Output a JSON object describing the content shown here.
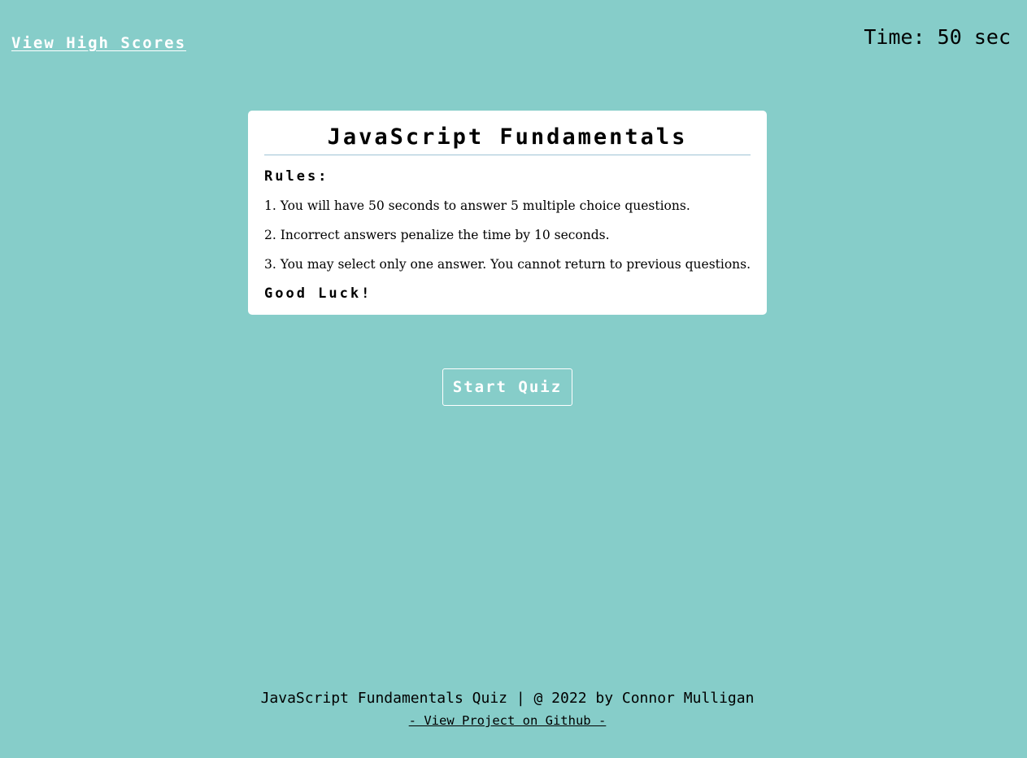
{
  "header": {
    "high_scores_label": "View High Scores",
    "timer_text": "Time: 50 sec"
  },
  "card": {
    "title": "JavaScript Fundamentals",
    "rules_heading": "Rules:",
    "rules": [
      "1. You will have 50 seconds to answer 5 multiple choice questions.",
      "2. Incorrect answers penalize the time by 10 seconds.",
      "3. You may select only one answer. You cannot return to previous questions."
    ],
    "closing": "Good Luck!"
  },
  "start_button_label": "Start Quiz",
  "footer": {
    "credit": "JavaScript Fundamentals Quiz | @ 2022 by Connor Mulligan",
    "github_link": "- View Project on Github -"
  },
  "colors": {
    "background": "#86cdc9",
    "card": "#ffffff",
    "accent_text": "#ffffff"
  }
}
